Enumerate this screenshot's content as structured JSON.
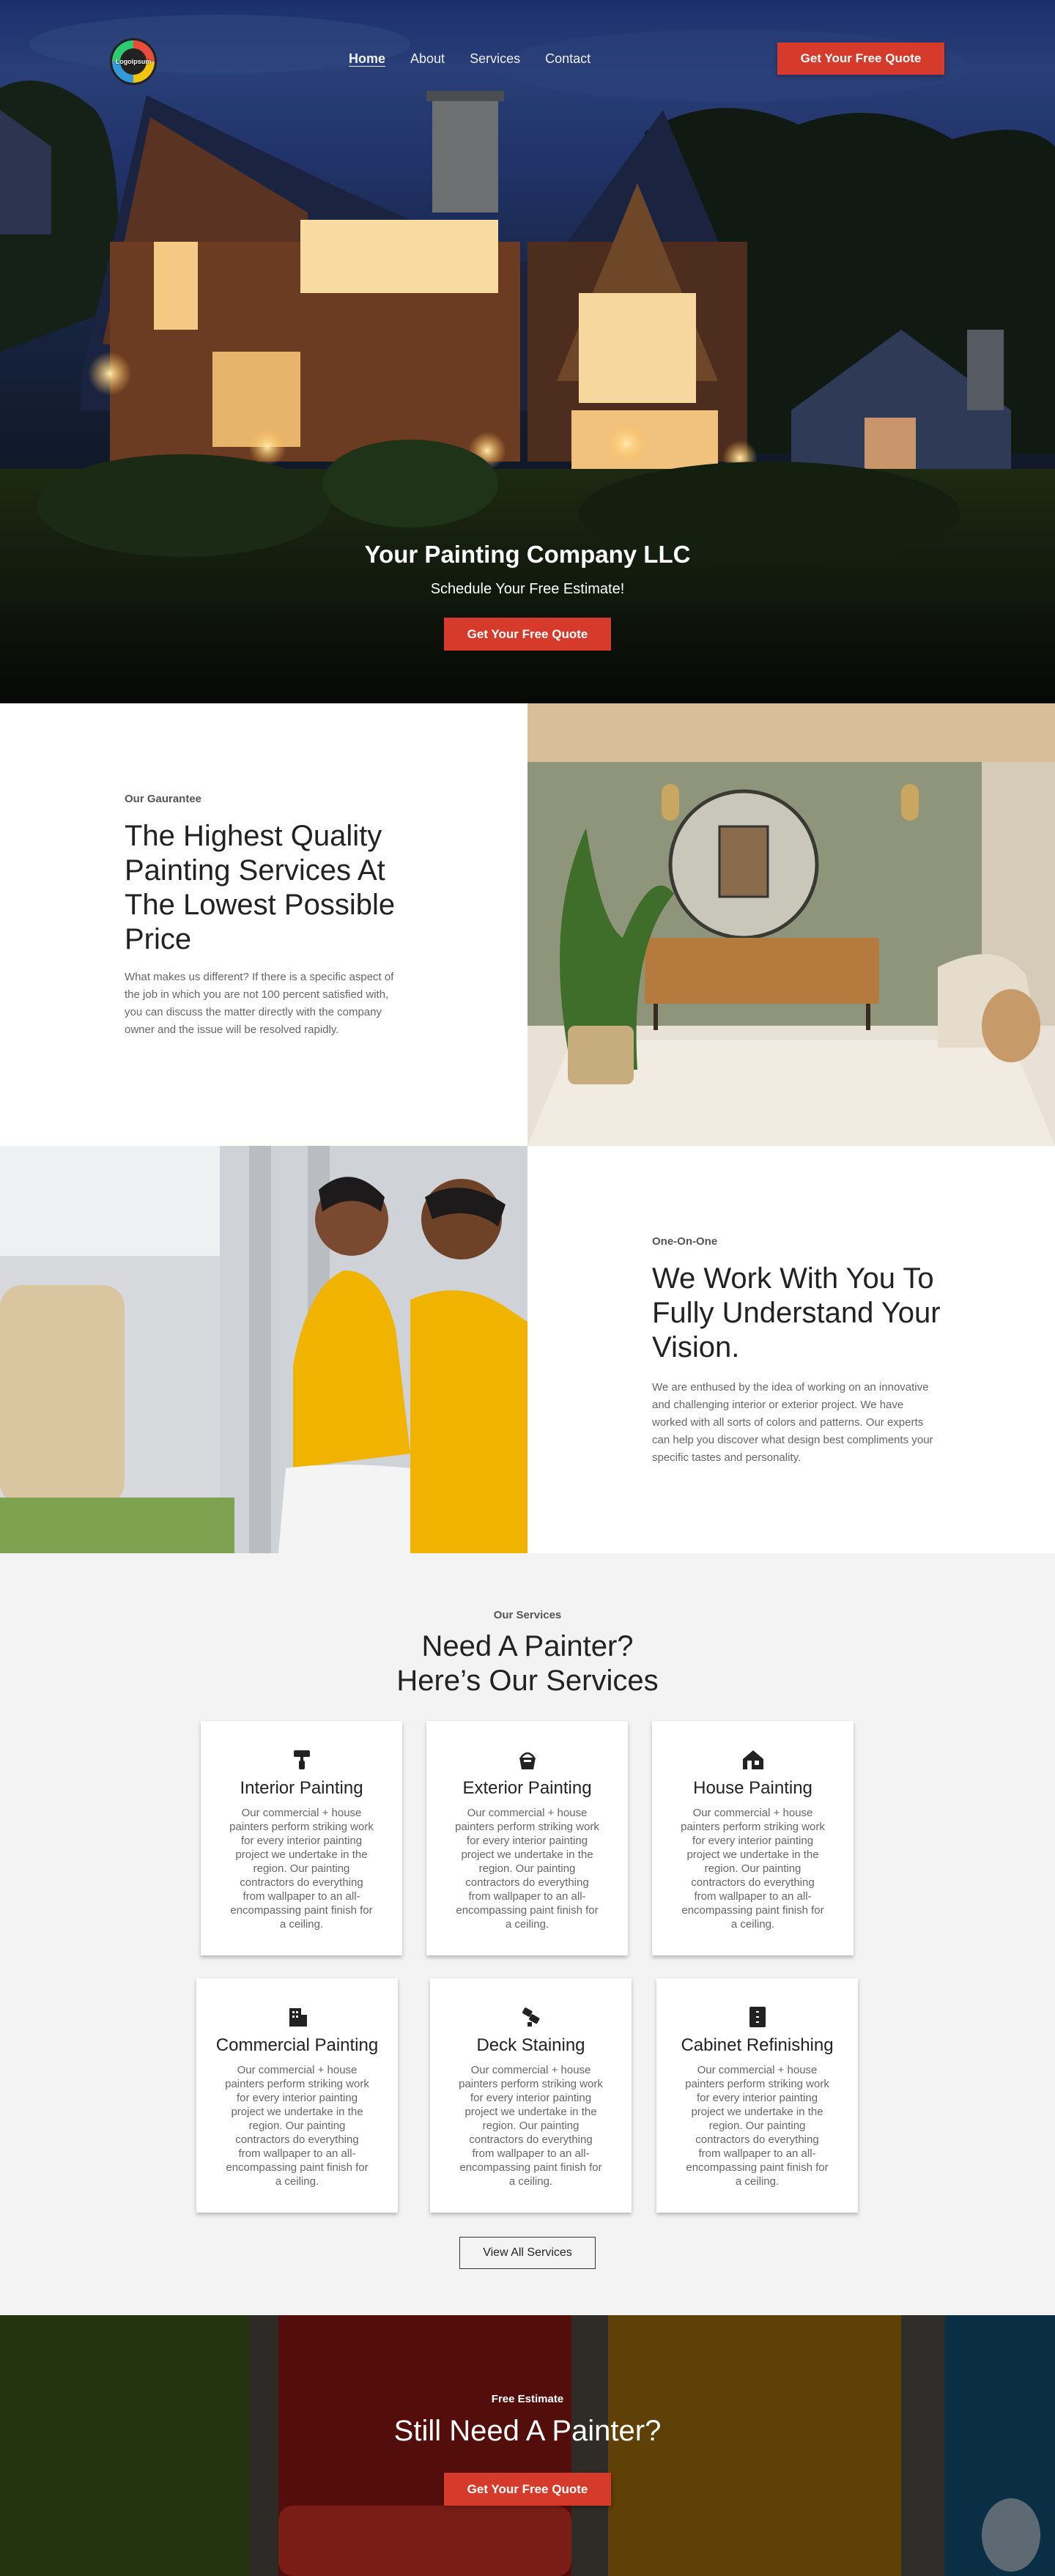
{
  "nav": {
    "logo_text": "Logoipsum",
    "links": [
      {
        "label": "Home",
        "active": true
      },
      {
        "label": "About",
        "active": false
      },
      {
        "label": "Services",
        "active": false
      },
      {
        "label": "Contact",
        "active": false
      }
    ],
    "cta_label": "Get Your Free Quote"
  },
  "hero": {
    "title": "Your Painting Company LLC",
    "subtitle": "Schedule Your Free Estimate!",
    "cta_label": "Get Your Free Quote"
  },
  "guarantee": {
    "eyebrow": "Our Gaurantee",
    "title": "The Highest Quality Painting Services At The Lowest Possible Price",
    "body": "What makes us different? If there is a specific aspect of the job in which you are not 100 percent satisfied with, you can discuss the matter directly with the company owner and the issue will be resolved rapidly."
  },
  "one_on_one": {
    "eyebrow": "One-On-One",
    "title": "We Work With You To Fully Understand Your Vision.",
    "body": "We are enthused by the idea of working on an innovative and challenging interior or exterior project. We have worked with all sorts of colors and patterns. Our experts can help you discover what design best compliments your specific tastes and personality."
  },
  "services": {
    "eyebrow": "Our Services",
    "title_line1": "Need A Painter?",
    "title_line2": "Here’s Our Services",
    "cards": [
      {
        "title": "Interior Painting",
        "icon": "paint-roller-icon",
        "body": "Our commercial + house painters perform striking work for every interior painting project we undertake in the region. Our painting contractors do everything from wallpaper to an all-encompassing paint finish for a ceiling."
      },
      {
        "title": "Exterior Painting",
        "icon": "paint-bucket-icon",
        "body": "Our commercial + house painters perform striking work for every interior painting project we undertake in the region. Our painting contractors do everything from wallpaper to an all-encompassing paint finish for a ceiling."
      },
      {
        "title": "House Painting",
        "icon": "house-icon",
        "body": "Our commercial + house painters perform striking work for every interior painting project we undertake in the region. Our painting contractors do everything from wallpaper to an all-encompassing paint finish for a ceiling."
      },
      {
        "title": "Commercial Painting",
        "icon": "building-icon",
        "body": "Our commercial + house painters perform striking work for every interior painting project we undertake in the region. Our painting contractors do everything from wallpaper to an all-encompassing paint finish for a ceiling."
      },
      {
        "title": "Deck Staining",
        "icon": "brush-icon",
        "body": "Our commercial + house painters perform striking work for every interior painting project we undertake in the region. Our painting contractors do everything from wallpaper to an all-encompassing paint finish for a ceiling."
      },
      {
        "title": "Cabinet Refinishing",
        "icon": "cabinet-icon",
        "body": "Our commercial + house painters perform striking work for every interior painting project we undertake in the region. Our painting contractors do everything from wallpaper to an all-encompassing paint finish for a ceiling."
      }
    ],
    "view_all_label": "View All Services"
  },
  "cta": {
    "eyebrow": "Free Estimate",
    "title": "Still Need A Painter?",
    "cta_label": "Get Your Free Quote"
  },
  "colors": {
    "accent": "#d63a2a",
    "services_bg": "#f3f3f3",
    "text_dark": "#222222",
    "text_muted": "#666666"
  }
}
